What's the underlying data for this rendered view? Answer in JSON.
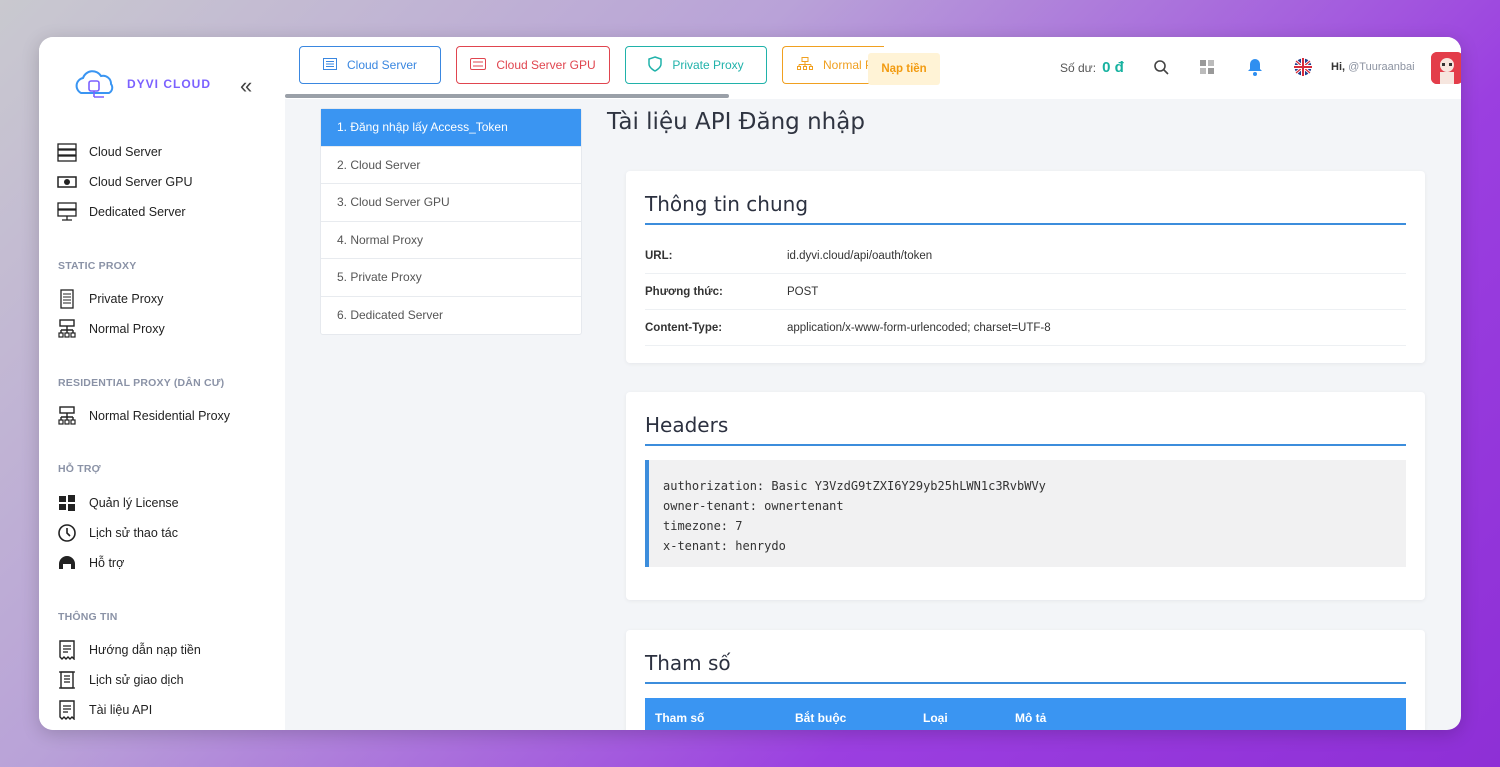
{
  "brand": {
    "name": "DYVI CLOUD"
  },
  "sidebar": {
    "groups": [
      {
        "title": "",
        "items": [
          {
            "label": "Cloud Server",
            "icon": "server-rack-icon"
          },
          {
            "label": "Cloud Server GPU",
            "icon": "gpu-card-icon"
          },
          {
            "label": "Dedicated Server",
            "icon": "dedicated-server-icon"
          }
        ]
      },
      {
        "title": "STATIC PROXY",
        "items": [
          {
            "label": "Private Proxy",
            "icon": "document-server-icon"
          },
          {
            "label": "Normal Proxy",
            "icon": "network-tree-icon"
          }
        ]
      },
      {
        "title": "RESIDENTIAL PROXY (DÂN CƯ)",
        "items": [
          {
            "label": "Normal Residential Proxy",
            "icon": "network-tree-icon"
          }
        ]
      },
      {
        "title": "HỖ TRỢ",
        "items": [
          {
            "label": "Quản lý License",
            "icon": "windows-icon"
          },
          {
            "label": "Lịch sử thao tác",
            "icon": "history-icon"
          },
          {
            "label": "Hỗ trợ",
            "icon": "headset-icon"
          }
        ]
      },
      {
        "title": "THÔNG TIN",
        "items": [
          {
            "label": "Hướng dẫn nạp tiền",
            "icon": "receipt-icon"
          },
          {
            "label": "Lịch sử giao dịch",
            "icon": "scroll-icon"
          },
          {
            "label": "Tài liệu API",
            "icon": "receipt-icon"
          }
        ]
      }
    ]
  },
  "topbar": {
    "tabs": [
      {
        "label": "Cloud Server",
        "icon": "list-icon"
      },
      {
        "label": "Cloud Server GPU",
        "icon": "gpu-card-icon"
      },
      {
        "label": "Private Proxy",
        "icon": "shield-icon"
      },
      {
        "label": "Normal P",
        "icon": "network-icon"
      }
    ],
    "topup_label": "Nạp tiền",
    "balance_label": "Số dư:",
    "balance_value": "0 đ",
    "greeting_prefix": "Hi,",
    "username": "@Tuuraanbai"
  },
  "api_menu": {
    "items": [
      "1. Đăng nhập lấy Access_Token",
      "2. Cloud Server",
      "3. Cloud Server GPU",
      "4. Normal Proxy",
      "5. Private Proxy",
      "6. Dedicated Server"
    ],
    "active_index": 0
  },
  "main": {
    "page_title": "Tài liệu API Đăng nhập",
    "general": {
      "title": "Thông tin chung",
      "rows": [
        {
          "key": "URL:",
          "value": "id.dyvi.cloud/api/oauth/token"
        },
        {
          "key": "Phương thức:",
          "value": "POST"
        },
        {
          "key": "Content-Type:",
          "value": "application/x-www-form-urlencoded; charset=UTF-8"
        }
      ]
    },
    "headers": {
      "title": "Headers",
      "lines": [
        "authorization: Basic Y3VzdG9tZXI6Y29yb25hLWN1c3RvbWVy",
        "owner-tenant: ownertenant",
        "timezone: 7",
        "x-tenant: henrydo"
      ]
    },
    "params": {
      "title": "Tham số",
      "columns": [
        "Tham số",
        "Bắt buộc",
        "Loại",
        "Mô tả"
      ]
    }
  },
  "colors": {
    "accent": "#3a95f2",
    "balance": "#17b2a0",
    "topup": "#f29b10"
  }
}
